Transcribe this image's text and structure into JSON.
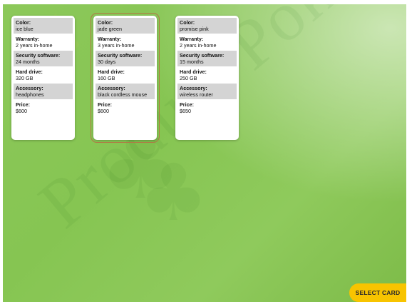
{
  "watermark": {
    "text": "Product Poker"
  },
  "cards": [
    {
      "attributes": [
        {
          "label": "Color:",
          "value": "ice blue"
        },
        {
          "label": "Warranty:",
          "value": "2 years in-home"
        },
        {
          "label": "Security software:",
          "value": "24 months"
        },
        {
          "label": "Hard drive:",
          "value": "320 GB"
        },
        {
          "label": "Accessory:",
          "value": "headphones"
        },
        {
          "label": "Price:",
          "value": "$600"
        }
      ]
    },
    {
      "attributes": [
        {
          "label": "Color:",
          "value": "jade green"
        },
        {
          "label": "Warranty:",
          "value": "3 years in-home"
        },
        {
          "label": "Security software:",
          "value": "30 days"
        },
        {
          "label": "Hard drive:",
          "value": "160 GB"
        },
        {
          "label": "Accessory:",
          "value": "black cordless mouse"
        },
        {
          "label": "Price:",
          "value": "$600"
        }
      ]
    },
    {
      "attributes": [
        {
          "label": "Color:",
          "value": "promise pink"
        },
        {
          "label": "Warranty:",
          "value": "2 years in-home"
        },
        {
          "label": "Security software:",
          "value": "15 months"
        },
        {
          "label": "Hard drive:",
          "value": "250 GB"
        },
        {
          "label": "Accessory:",
          "value": "wireless router"
        },
        {
          "label": "Price:",
          "value": "$650"
        }
      ]
    }
  ],
  "select_button": {
    "label": "SELECT CARD"
  },
  "colors": {
    "background": "#86c552",
    "button": "#f8c400",
    "selected_outline": "#b07a45"
  }
}
